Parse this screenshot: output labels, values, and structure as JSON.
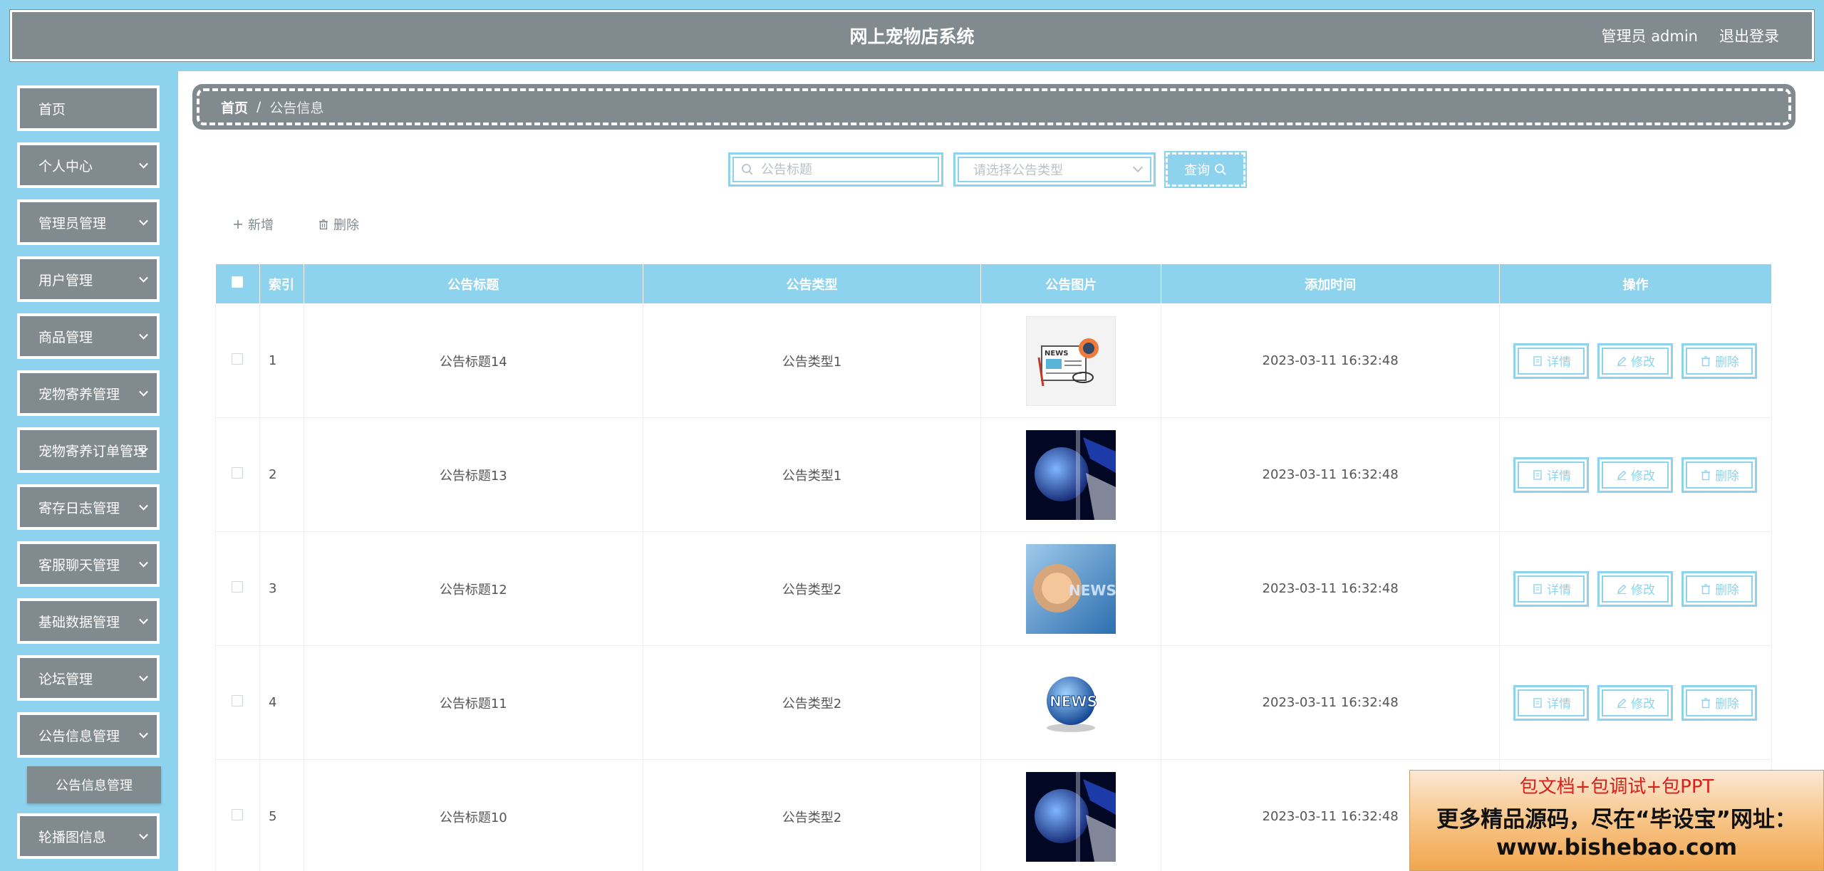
{
  "header": {
    "title": "网上宠物店系统",
    "user_label": "管理员 admin",
    "logout_label": "退出登录"
  },
  "sidebar": {
    "items": [
      {
        "label": "首页",
        "has_chevron": false
      },
      {
        "label": "个人中心",
        "has_chevron": true
      },
      {
        "label": "管理员管理",
        "has_chevron": true
      },
      {
        "label": "用户管理",
        "has_chevron": true
      },
      {
        "label": "商品管理",
        "has_chevron": true
      },
      {
        "label": "宠物寄养管理",
        "has_chevron": true
      },
      {
        "label": "宠物寄养订单管理",
        "has_chevron": true
      },
      {
        "label": "寄存日志管理",
        "has_chevron": true
      },
      {
        "label": "客服聊天管理",
        "has_chevron": true
      },
      {
        "label": "基础数据管理",
        "has_chevron": true
      },
      {
        "label": "论坛管理",
        "has_chevron": true
      },
      {
        "label": "公告信息管理",
        "has_chevron": true
      }
    ],
    "submenu_label": "公告信息管理",
    "last_item": "轮播图信息"
  },
  "breadcrumb": {
    "home": "首页",
    "separator": "/",
    "current": "公告信息"
  },
  "search": {
    "title_placeholder": "公告标题",
    "type_placeholder": "请选择公告类型",
    "query_label": "查询"
  },
  "toolbar": {
    "add_label": "新增",
    "delete_label": "删除"
  },
  "table": {
    "headers": [
      "索引",
      "公告标题",
      "公告类型",
      "公告图片",
      "添加时间",
      "操作"
    ],
    "rows": [
      {
        "index": "1",
        "title": "公告标题14",
        "type": "公告类型1",
        "image": "newspaper-icon",
        "time": "2023-03-11 16:32:48"
      },
      {
        "index": "2",
        "title": "公告标题13",
        "type": "公告类型1",
        "image": "globe-news-image",
        "time": "2023-03-11 16:32:48"
      },
      {
        "index": "3",
        "title": "公告标题12",
        "type": "公告类型2",
        "image": "news-banner-image",
        "time": "2023-03-11 16:32:48"
      },
      {
        "index": "4",
        "title": "公告标题11",
        "type": "公告类型2",
        "image": "news-globe-logo",
        "time": "2023-03-11 16:32:48"
      },
      {
        "index": "5",
        "title": "公告标题10",
        "type": "公告类型2",
        "image": "globe-news-image",
        "time": "2023-03-11 16:32:48"
      }
    ],
    "actions": {
      "detail": "详情",
      "edit": "修改",
      "delete": "删除"
    }
  },
  "promo": {
    "line1": "包文档+包调试+包PPT",
    "line2": "更多精品源码，尽在“毕设宝”网址：",
    "line3": "www.bishebao.com"
  },
  "colors": {
    "accent": "#8ed3ee",
    "panel_gray": "#808a8f",
    "promo_red": "#d8201e"
  }
}
